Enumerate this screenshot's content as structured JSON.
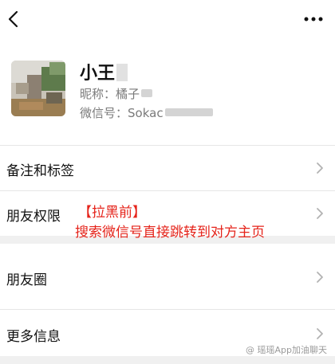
{
  "nav": {
    "back_icon": "chevron-left-icon",
    "more_icon": "more-dots-icon"
  },
  "profile": {
    "name": "小王",
    "nickname_label": "昵称：",
    "nickname_value": "橘子",
    "wechat_id_label": "微信号：",
    "wechat_id_value": "Sokac"
  },
  "rows": [
    {
      "label": "备注和标签"
    },
    {
      "label": "朋友权限"
    },
    {
      "label": "朋友圈"
    },
    {
      "label": "更多信息"
    }
  ],
  "annotation": {
    "line1": "【拉黑前】",
    "line2": "搜索微信号直接跳转到对方主页",
    "color": "#e5231a"
  },
  "watermark": "@ 瑶瑶App加油聊天"
}
